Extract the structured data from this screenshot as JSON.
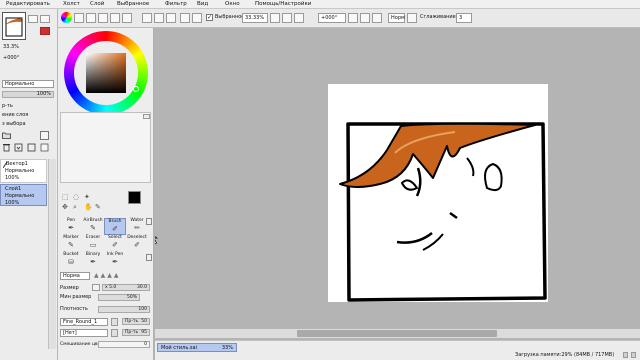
{
  "menu": {
    "items": [
      "Редактировать",
      "Холст",
      "Слой",
      "Выбранное",
      "Фильтр",
      "Вид",
      "Окно",
      "Помощь/Настройки"
    ]
  },
  "toolbar": {
    "selected_checkbox_label": "Выбранное",
    "zoom": "33.33%",
    "rotation": "+000°",
    "blend_mode": "Норм",
    "stabilizer_label": "Стаб",
    "stabilizer_full_label": "Сглаживание",
    "stabilizer_value": "3"
  },
  "navigator": {
    "zoom": "33.3%",
    "rotation": "+000°"
  },
  "layer_panel": {
    "blend_mode": "Нормально",
    "opacity": "100%",
    "option_1": "р-ть",
    "option_2": "ение слоя",
    "option_3": "з выбора",
    "layers": [
      {
        "name": "Вектор1",
        "mode": "Нормально",
        "opacity": "100%"
      },
      {
        "name": "Слой1",
        "mode": "Нормально",
        "opacity": "100%"
      }
    ]
  },
  "tools": {
    "row1": [
      "Pen",
      "AirBrush",
      "Brush",
      "Water"
    ],
    "row2": [
      "Marker",
      "Eraser",
      "Select",
      "Deselect"
    ],
    "row3": [
      "Bucket",
      "Binary",
      "Ink Pen"
    ],
    "selected": "Brush"
  },
  "brush_settings": {
    "blend": "Норма",
    "size_label": "Размер",
    "size_multiplier": "x 5.0",
    "size_value": "30.0",
    "min_size_label": "Мин размер",
    "min_size_value": "50%",
    "density_label": "Плотность",
    "density_value": "100",
    "shape_label": "Fine_Round_1",
    "shape_strength": "Пр-ть",
    "shape_strength_value": "50",
    "texture_label": "[Нет]",
    "texture_strength": "Пр-ть",
    "texture_strength_value": "95",
    "mix_label": "Смешивание цвет",
    "mix_value": "0"
  },
  "status": {
    "canvas_name": "Мой стиль.sai",
    "canvas_zoom": "33%",
    "memory": "Загрузка памяти:29% (84MB / 717MB)"
  },
  "colors": {
    "accent": "#b4c8f0",
    "hair": "#c8641c",
    "canvas_bg": "#b4b4b4"
  }
}
